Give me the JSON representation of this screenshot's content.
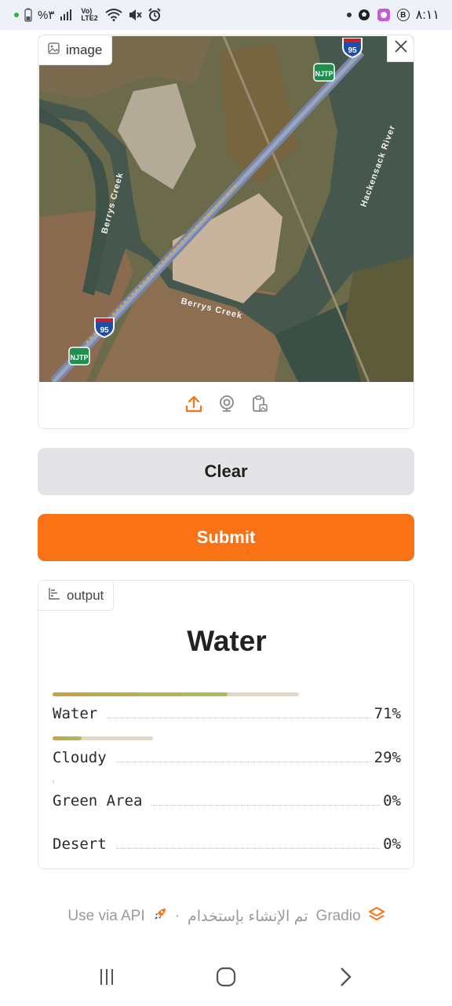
{
  "status_bar": {
    "left_text": "%٣",
    "network": "Vo) LTE2",
    "time": "٨:١١",
    "badge": "B"
  },
  "image_input": {
    "label": "image",
    "map_labels": {
      "creek_vertical": "Berrys Creek",
      "creek_horizontal": "Berrys Creek",
      "river": "Hackensack River",
      "highway_top": "95",
      "highway_bottom": "95",
      "turnpike": "NJTP"
    }
  },
  "buttons": {
    "clear": "Clear",
    "submit": "Submit"
  },
  "output": {
    "label": "output",
    "top_class": "Water",
    "confidences": [
      {
        "label": "Water",
        "percent_text": "71%",
        "value": 0.71
      },
      {
        "label": "Cloudy",
        "percent_text": "29%",
        "value": 0.29
      },
      {
        "label": "Green Area",
        "percent_text": "0%",
        "value": 0.0
      },
      {
        "label": "Desert",
        "percent_text": "0%",
        "value": 0.0
      }
    ]
  },
  "footer": {
    "api_link": "Use via API",
    "separator": "·",
    "built_with": "تم الإنشاء بإستخدام",
    "gradio": "Gradio"
  },
  "colors": {
    "accent": "#f97316",
    "clear_bg": "#e4e4e7"
  }
}
